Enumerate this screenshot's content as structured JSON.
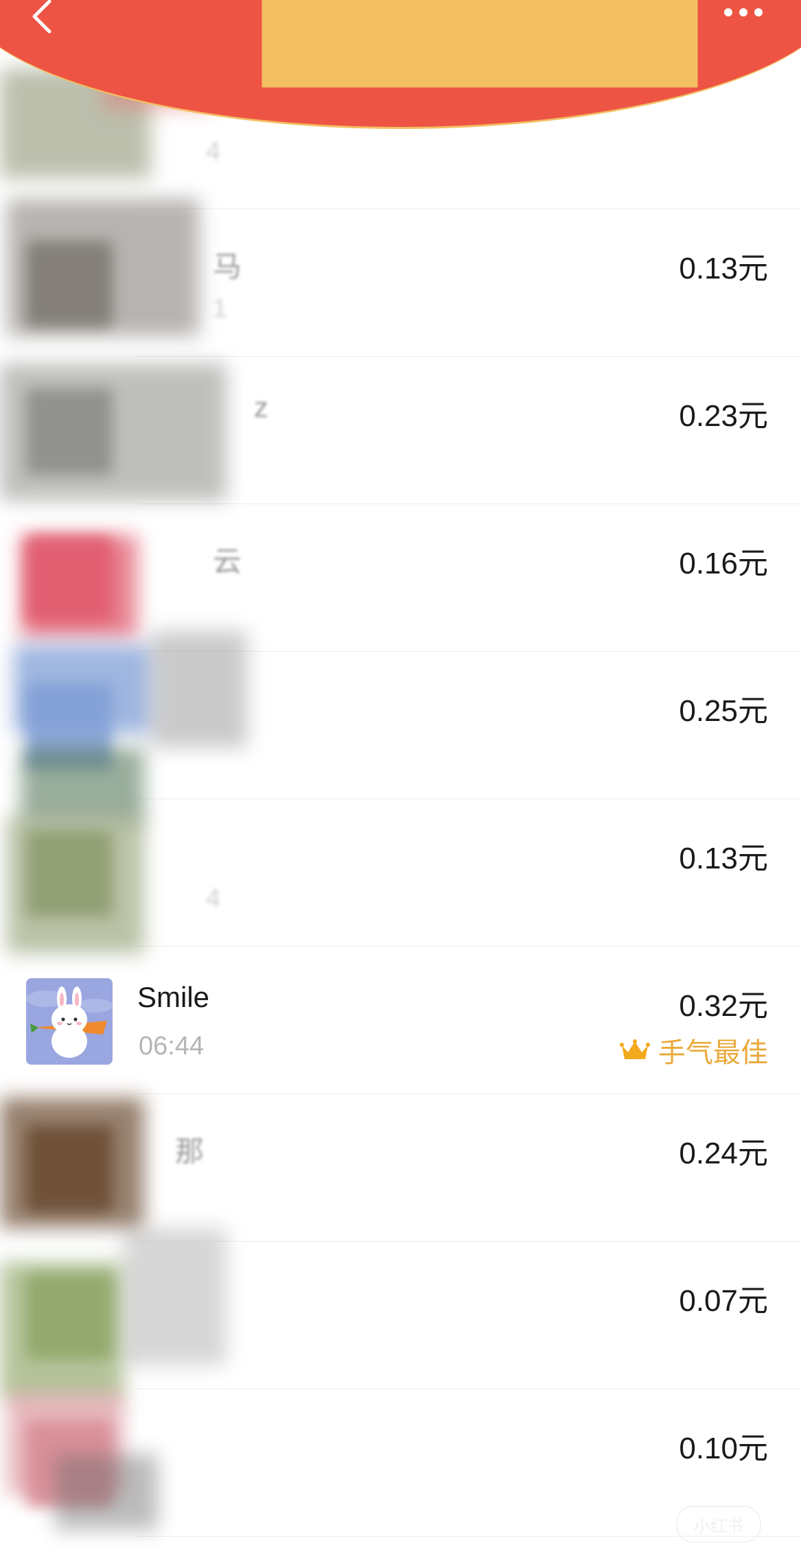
{
  "header": {
    "back_icon": "chevron-left-icon",
    "more_icon": "ellipsis-icon",
    "color": "#ee5444",
    "accent": "#f3bf62"
  },
  "list": [
    {
      "name": "",
      "time": "4",
      "amount": "",
      "best": false,
      "blurred": true
    },
    {
      "name": "马",
      "time": "1",
      "amount": "0.13元",
      "best": false,
      "blurred": true
    },
    {
      "name": "z",
      "time": "",
      "amount": "0.23元",
      "best": false,
      "blurred": true
    },
    {
      "name": "云",
      "time": "",
      "amount": "0.16元",
      "best": false,
      "blurred": true
    },
    {
      "name": "",
      "time": "",
      "amount": "0.25元",
      "best": false,
      "blurred": true
    },
    {
      "name": "",
      "time": "4",
      "amount": "0.13元",
      "best": false,
      "blurred": true
    },
    {
      "name": "Smile",
      "time": "06:44",
      "amount": "0.32元",
      "best": true,
      "best_label": "手气最佳",
      "blurred": false
    },
    {
      "name": "那",
      "time": "",
      "amount": "0.24元",
      "best": false,
      "blurred": true
    },
    {
      "name": "",
      "time": "",
      "amount": "0.07元",
      "best": false,
      "blurred": true
    },
    {
      "name": "",
      "time": "",
      "amount": "0.10元",
      "best": false,
      "blurred": true
    }
  ],
  "colors": {
    "best_gold": "#e9a93a",
    "avatar_bg": "#9aa6e0"
  },
  "watermark": "小红书"
}
